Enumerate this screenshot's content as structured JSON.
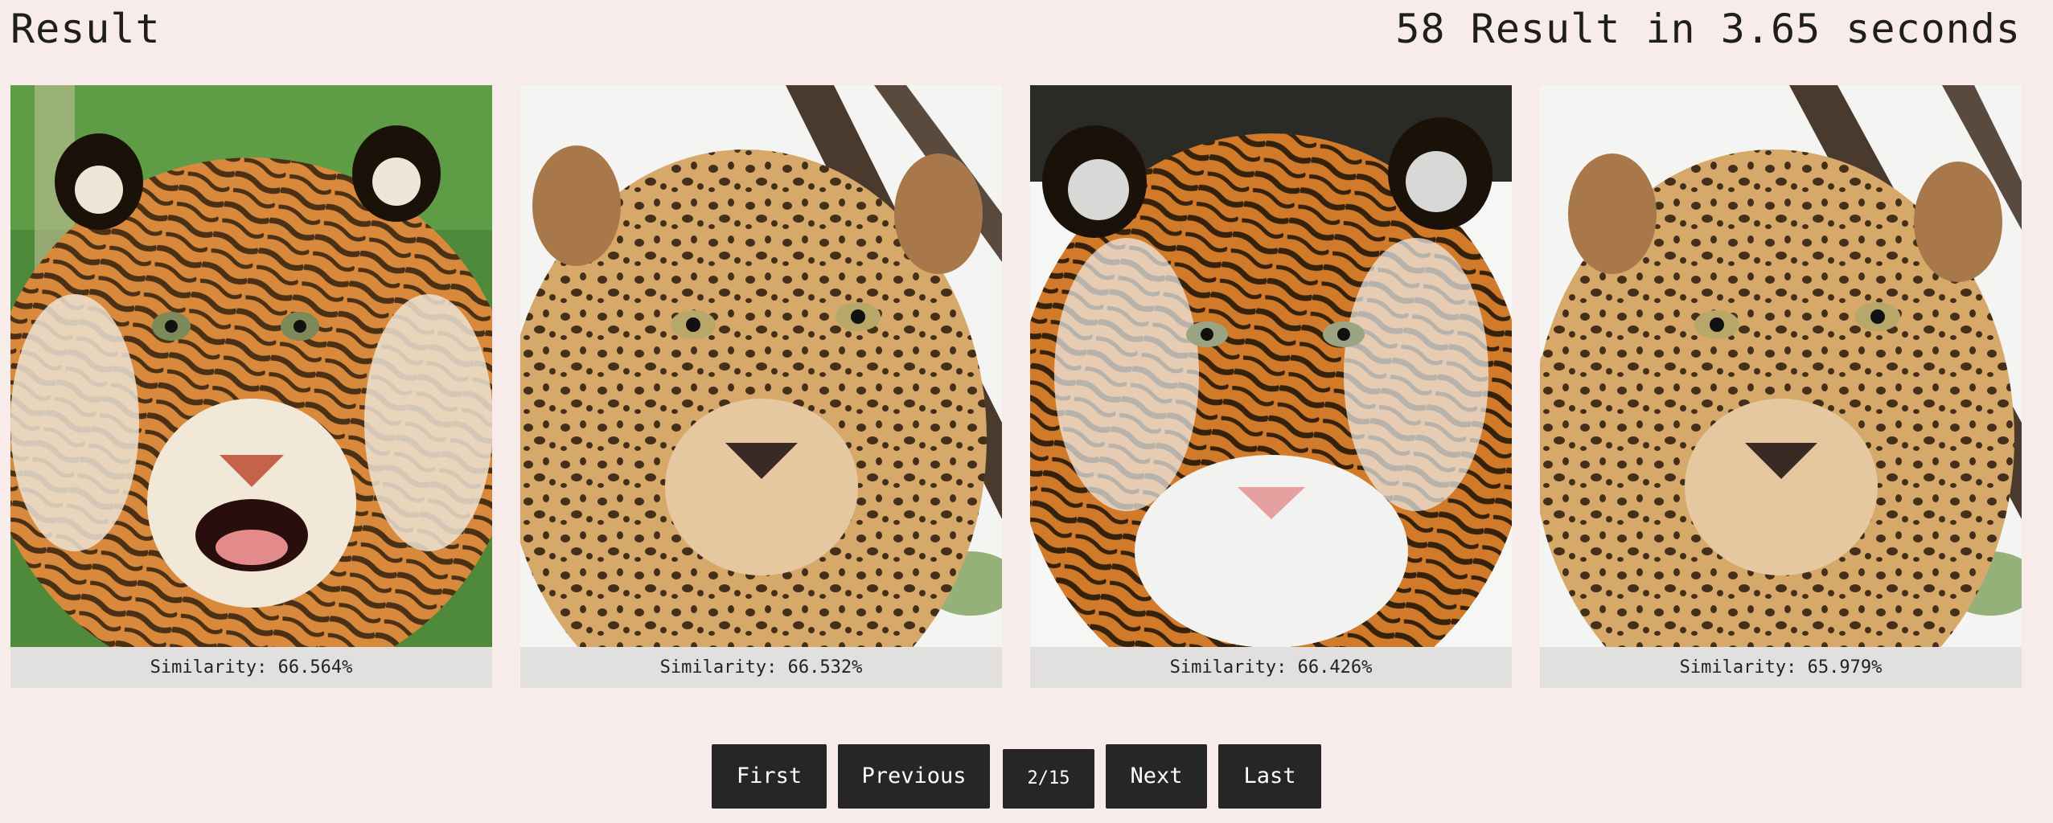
{
  "header": {
    "title": "Result",
    "summary": "58 Result in 3.65 seconds"
  },
  "results": [
    {
      "caption": "Similarity: 66.564%",
      "subject": "tiger"
    },
    {
      "caption": "Similarity: 66.532%",
      "subject": "leopard"
    },
    {
      "caption": "Similarity: 66.426%",
      "subject": "tiger"
    },
    {
      "caption": "Similarity: 65.979%",
      "subject": "leopard"
    }
  ],
  "pagination": {
    "first": "First",
    "previous": "Previous",
    "page": "2/15",
    "next": "Next",
    "last": "Last"
  },
  "colors": {
    "background": "#f7ecea",
    "caption_bg": "#e1e0df",
    "button_bg": "#262626"
  }
}
